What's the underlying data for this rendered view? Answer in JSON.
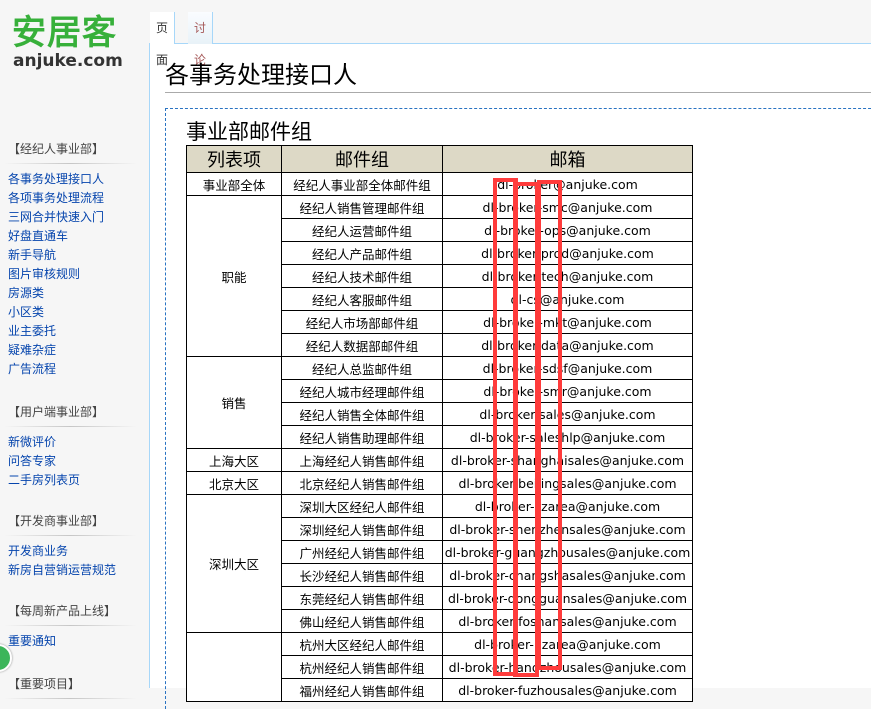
{
  "logo": {
    "chinese": "安居客",
    "english": "anjuke.com"
  },
  "tabs": [
    {
      "label": "页面"
    },
    {
      "label": "讨论"
    }
  ],
  "page_title": "各事务处理接口人",
  "sidebar": {
    "portals": [
      {
        "title": "【经纪人事业部】",
        "items": [
          "各事务处理接口人",
          "各项事务处理流程",
          "三网合并快速入门",
          "好盘直通车",
          "新手导航",
          "图片审核规则",
          "房源类",
          "小区类",
          "业主委托",
          "疑难杂症",
          "广告流程"
        ]
      },
      {
        "title": "【用户端事业部】",
        "items": [
          "新微评价",
          "问答专家",
          "二手房列表页"
        ]
      },
      {
        "title": "【开发商事业部】",
        "items": [
          "开发商业务",
          "新房自营销运营规范"
        ]
      },
      {
        "title": "【每周新产品上线】",
        "items": [
          "重要通知"
        ]
      },
      {
        "title": "【重要项目】",
        "items": []
      }
    ]
  },
  "section_title": "事业部邮件组",
  "table": {
    "headers": [
      "列表项",
      "邮件组",
      "邮箱"
    ],
    "groups": [
      {
        "category": "事业部全体",
        "rows": [
          [
            "经纪人事业部全体邮件组",
            "dl-broker@anjuke.com"
          ]
        ]
      },
      {
        "category": "职能",
        "rows": [
          [
            "经纪人销售管理邮件组",
            "dl-broker-smc@anjuke.com"
          ],
          [
            "经纪人运营邮件组",
            "dl-broker-ops@anjuke.com"
          ],
          [
            "经纪人产品邮件组",
            "dl-broker-prod@anjuke.com"
          ],
          [
            "经纪人技术邮件组",
            "dl-broker-tech@anjuke.com"
          ],
          [
            "经纪人客服邮件组",
            "dl-cs@anjuke.com"
          ],
          [
            "经纪人市场部邮件组",
            "dl-broker-mkt@anjuke.com"
          ],
          [
            "经纪人数据部邮件组",
            "dl-broker-data@anjuke.com"
          ]
        ]
      },
      {
        "category": "销售",
        "rows": [
          [
            "经纪人总监邮件组",
            "dl-broker-sdsf@anjuke.com"
          ],
          [
            "经纪人城市经理邮件组",
            "dl-broker-smr@anjuke.com"
          ],
          [
            "经纪人销售全体邮件组",
            "dl-broker-sales@anjuke.com"
          ],
          [
            "经纪人销售助理邮件组",
            "dl-broker-saleshlp@anjuke.com"
          ]
        ]
      },
      {
        "category": "上海大区",
        "rows": [
          [
            "上海经纪人销售邮件组",
            "dl-broker-shanghaisales@anjuke.com"
          ]
        ]
      },
      {
        "category": "北京大区",
        "rows": [
          [
            "北京经纪人销售邮件组",
            "dl-broker-beijingsales@anjuke.com"
          ]
        ]
      },
      {
        "category": "深圳大区",
        "rows": [
          [
            "深圳大区经纪人邮件组",
            "dl-broker-szarea@anjuke.com"
          ],
          [
            "深圳经纪人销售邮件组",
            "dl-broker-shenzhensales@anjuke.com"
          ],
          [
            "广州经纪人销售邮件组",
            "dl-broker-guangzhousales@anjuke.com"
          ],
          [
            "长沙经纪人销售邮件组",
            "dl-broker-changshasales@anjuke.com"
          ],
          [
            "东莞经纪人销售邮件组",
            "dl-broker-dongguansales@anjuke.com"
          ],
          [
            "佛山经纪人销售邮件组",
            "dl-broker-foshansales@anjuke.com"
          ]
        ]
      },
      {
        "category": "",
        "rows": [
          [
            "杭州大区经纪人邮件组",
            "dl-broker-hzarea@anjuke.com"
          ],
          [
            "杭州经纪人销售邮件组",
            "dl-broker-hangzhousales@anjuke.com"
          ],
          [
            "福州经纪人销售邮件组",
            "dl-broker-fuzhousales@anjuke.com"
          ]
        ]
      }
    ]
  },
  "colors": {
    "logo_green": "#37b03a",
    "link": "#0645ad",
    "header_bg": "#ddd9c6",
    "highlight": "#ff3b3b"
  }
}
